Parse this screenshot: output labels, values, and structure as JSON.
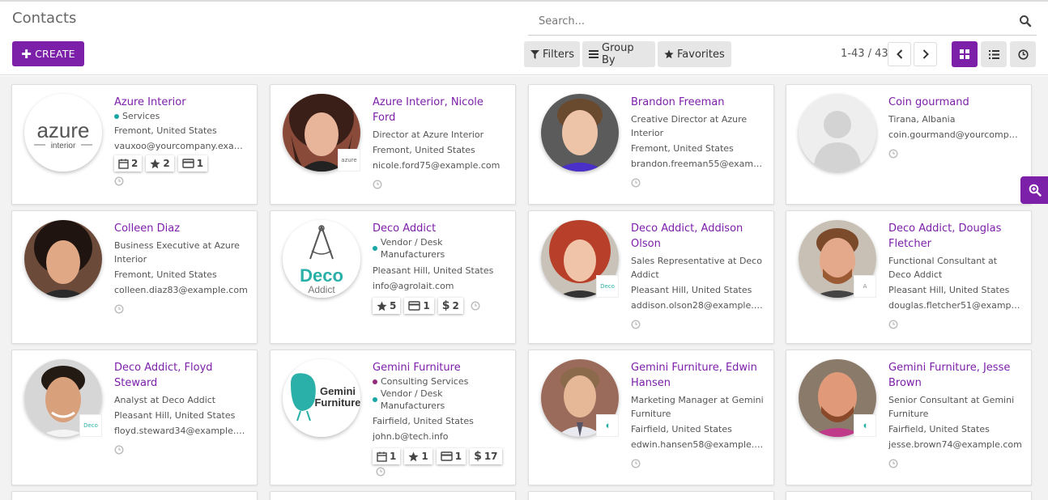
{
  "breadcrumb": "Contacts",
  "search": {
    "placeholder": "Search..."
  },
  "create_label": "CREATE",
  "filters": {
    "filters_label": "Filters",
    "group_by_label": "Group By",
    "favorites_label": "Favorites"
  },
  "pager": {
    "value": "1-43 / 43"
  },
  "colors": {
    "brand": "#7c1fa9",
    "tag_teal": "#1aa6a6",
    "tag_purple": "#8e2b7b"
  },
  "contacts": [
    {
      "name": "Azure Interior",
      "tags": [
        "Services"
      ],
      "job": "",
      "location": "Fremont, United States",
      "email": "vauxoo@yourcompany.exam...",
      "activity": {
        "meetings": "2",
        "stars": "2",
        "cards": "1"
      }
    },
    {
      "name": "Azure Interior, Nicole Ford",
      "job": "Director at Azure Interior",
      "location": "Fremont, United States",
      "email": "nicole.ford75@example.com",
      "company_logo": "azure"
    },
    {
      "name": "Brandon Freeman",
      "job": "Creative Director at Azure Interior",
      "location": "Fremont, United States",
      "email": "brandon.freeman55@exampl..."
    },
    {
      "name": "Coin gourmand",
      "location": "Tirana, Albania",
      "email": "coin.gourmand@yourcompan..."
    },
    {
      "name": "Colleen Diaz",
      "job": "Business Executive at Azure Interior",
      "location": "Fremont, United States",
      "email": "colleen.diaz83@example.com"
    },
    {
      "name": "Deco Addict",
      "tags": [
        "Vendor / Desk Manufacturers"
      ],
      "location": "Pleasant Hill, United States",
      "email": "info@agrolait.com",
      "activity": {
        "stars": "5",
        "cards": "1",
        "dollars": "2"
      }
    },
    {
      "name": "Deco Addict, Addison Olson",
      "job": "Sales Representative at Deco Addict",
      "location": "Pleasant Hill, United States",
      "email": "addison.olson28@example.c...",
      "company_logo": "Deco"
    },
    {
      "name": "Deco Addict, Douglas Fletcher",
      "job": "Functional Consultant at Deco Addict",
      "location": "Pleasant Hill, United States",
      "email": "douglas.fletcher51@example..."
    },
    {
      "name": "Deco Addict, Floyd Steward",
      "job": "Analyst at Deco Addict",
      "location": "Pleasant Hill, United States",
      "email": "floyd.steward34@example.com",
      "company_logo": "Deco"
    },
    {
      "name": "Gemini Furniture",
      "tags": [
        "Consulting Services",
        "Vendor / Desk Manufacturers"
      ],
      "location": "Fairfield, United States",
      "email": "john.b@tech.info",
      "activity": {
        "meetings": "1",
        "stars": "1",
        "cards": "1",
        "dollars": "17"
      }
    },
    {
      "name": "Gemini Furniture, Edwin Hansen",
      "job": "Marketing Manager at Gemini Furniture",
      "location": "Fairfield, United States",
      "email": "edwin.hansen58@example.c..."
    },
    {
      "name": "Gemini Furniture, Jesse Brown",
      "job": "Senior Consultant at Gemini Furniture",
      "location": "Fairfield, United States",
      "email": "jesse.brown74@example.com"
    }
  ],
  "logos": {
    "azure_main": "azure",
    "azure_sub": "interior",
    "deco_main": "Deco",
    "deco_sub": "Addict",
    "gemini_line1": "Gemini",
    "gemini_line2": "Furniture"
  }
}
